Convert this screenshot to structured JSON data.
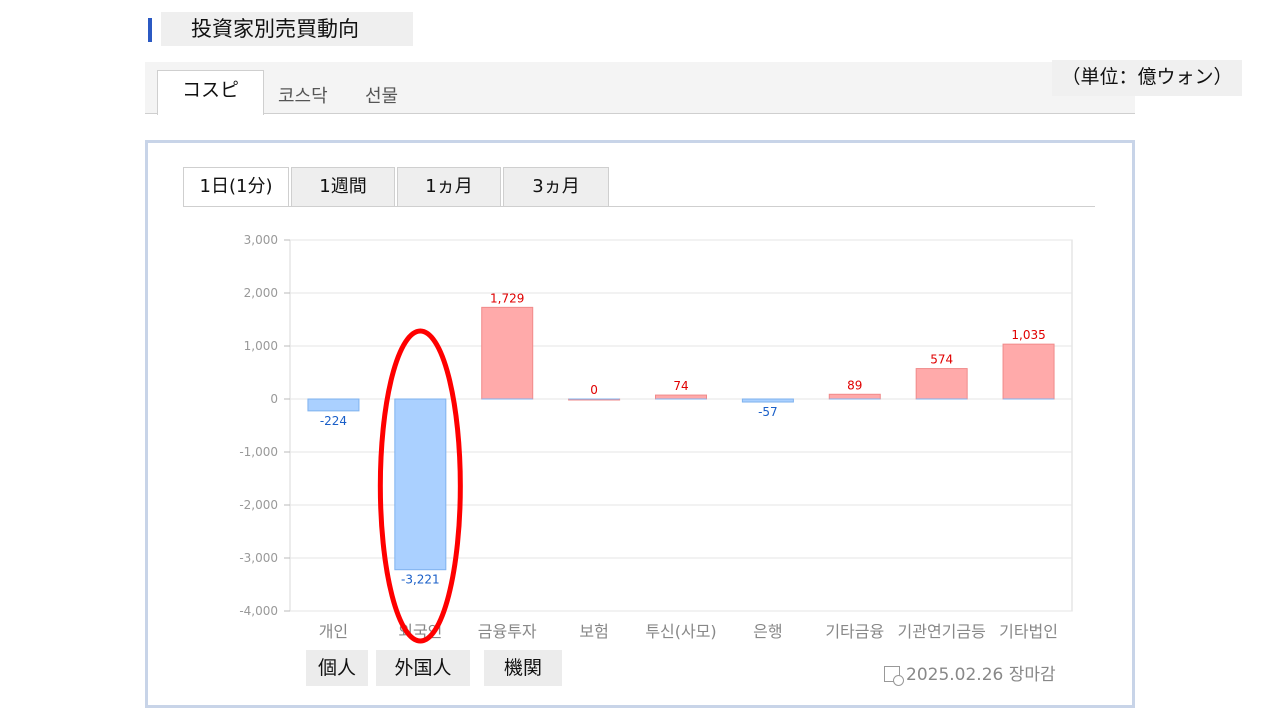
{
  "header": {
    "title": "投資家別売買動向"
  },
  "market_tabs": {
    "active": "コスピ",
    "others": [
      "코스닥",
      "선물"
    ]
  },
  "unit": "（単位：億ウォン）",
  "period_tabs": [
    "1日(1分)",
    "1週間",
    "1ヵ月",
    "3ヵ月"
  ],
  "investor_labels": {
    "individual": "個人",
    "foreign": "外国人",
    "institution": "機関"
  },
  "date_text": "2025.02.26 장마감",
  "colors": {
    "positive": "#ffaaaa",
    "negative": "#aad0ff",
    "positive_label": "#e00000",
    "negative_label": "#1a5fc8",
    "highlight": "#ff0000"
  },
  "chart_data": {
    "type": "bar",
    "categories": [
      "개인",
      "외국인",
      "금융투자",
      "보험",
      "투신(사모)",
      "은행",
      "기타금융",
      "기관연기금등",
      "기타법인"
    ],
    "values": [
      -224,
      -3221,
      1729,
      0,
      74,
      -57,
      89,
      574,
      1035
    ],
    "value_labels": [
      "-224",
      "-3,221",
      "1,729",
      "0",
      "74",
      "-57",
      "89",
      "574",
      "1,035"
    ],
    "ylim": [
      -4000,
      3000
    ],
    "yticks": [
      3000,
      2000,
      1000,
      0,
      -1000,
      -2000,
      -3000,
      -4000
    ],
    "ytick_labels": [
      "3,000",
      "2,000",
      "1,000",
      "0",
      "-1,000",
      "-2,000",
      "-3,000",
      "-4,000"
    ],
    "grid": true,
    "highlighted_category": "외국인"
  }
}
